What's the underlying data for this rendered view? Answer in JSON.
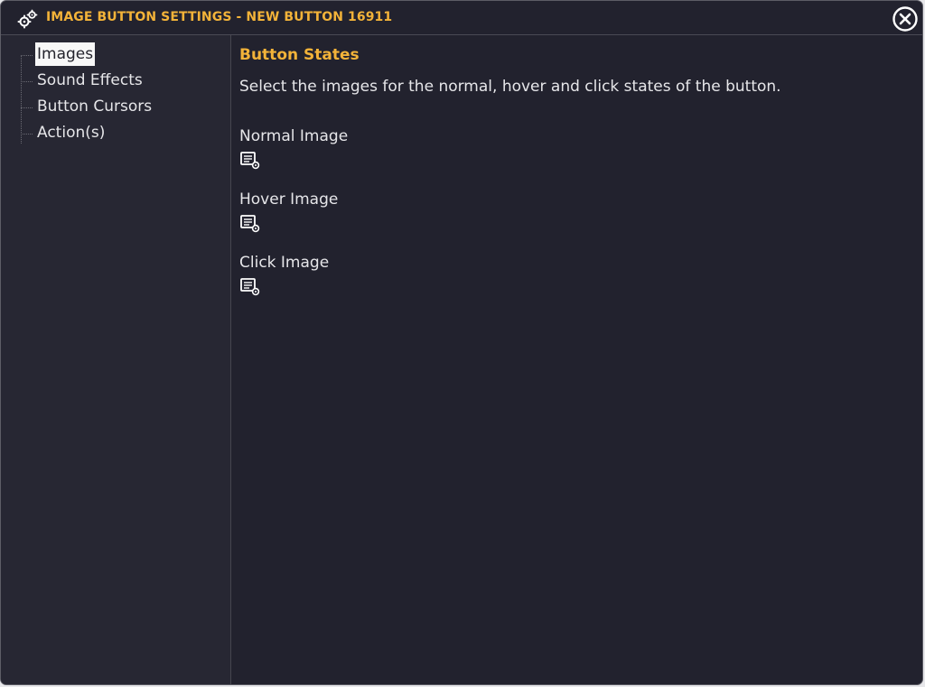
{
  "window": {
    "title": "IMAGE BUTTON SETTINGS - NEW BUTTON 16911",
    "title_icon": "settings-gear-icon",
    "close_icon": "close-circle-icon"
  },
  "sidebar": {
    "items": [
      {
        "label": "Images",
        "selected": true
      },
      {
        "label": "Sound Effects",
        "selected": false
      },
      {
        "label": "Button Cursors",
        "selected": false
      },
      {
        "label": "Action(s)",
        "selected": false
      }
    ]
  },
  "main": {
    "section_title": "Button States",
    "description": "Select the images for the normal, hover and click states of the button.",
    "states": [
      {
        "label": "Normal Image",
        "icon": "browse-image-icon"
      },
      {
        "label": "Hover Image",
        "icon": "browse-image-icon"
      },
      {
        "label": "Click Image",
        "icon": "browse-image-icon"
      }
    ]
  },
  "colors": {
    "background": "#22222e",
    "sidebar": "#272733",
    "accent": "#f3b339",
    "text": "#e6e6e9",
    "selected_bg": "#f7f7f7"
  }
}
